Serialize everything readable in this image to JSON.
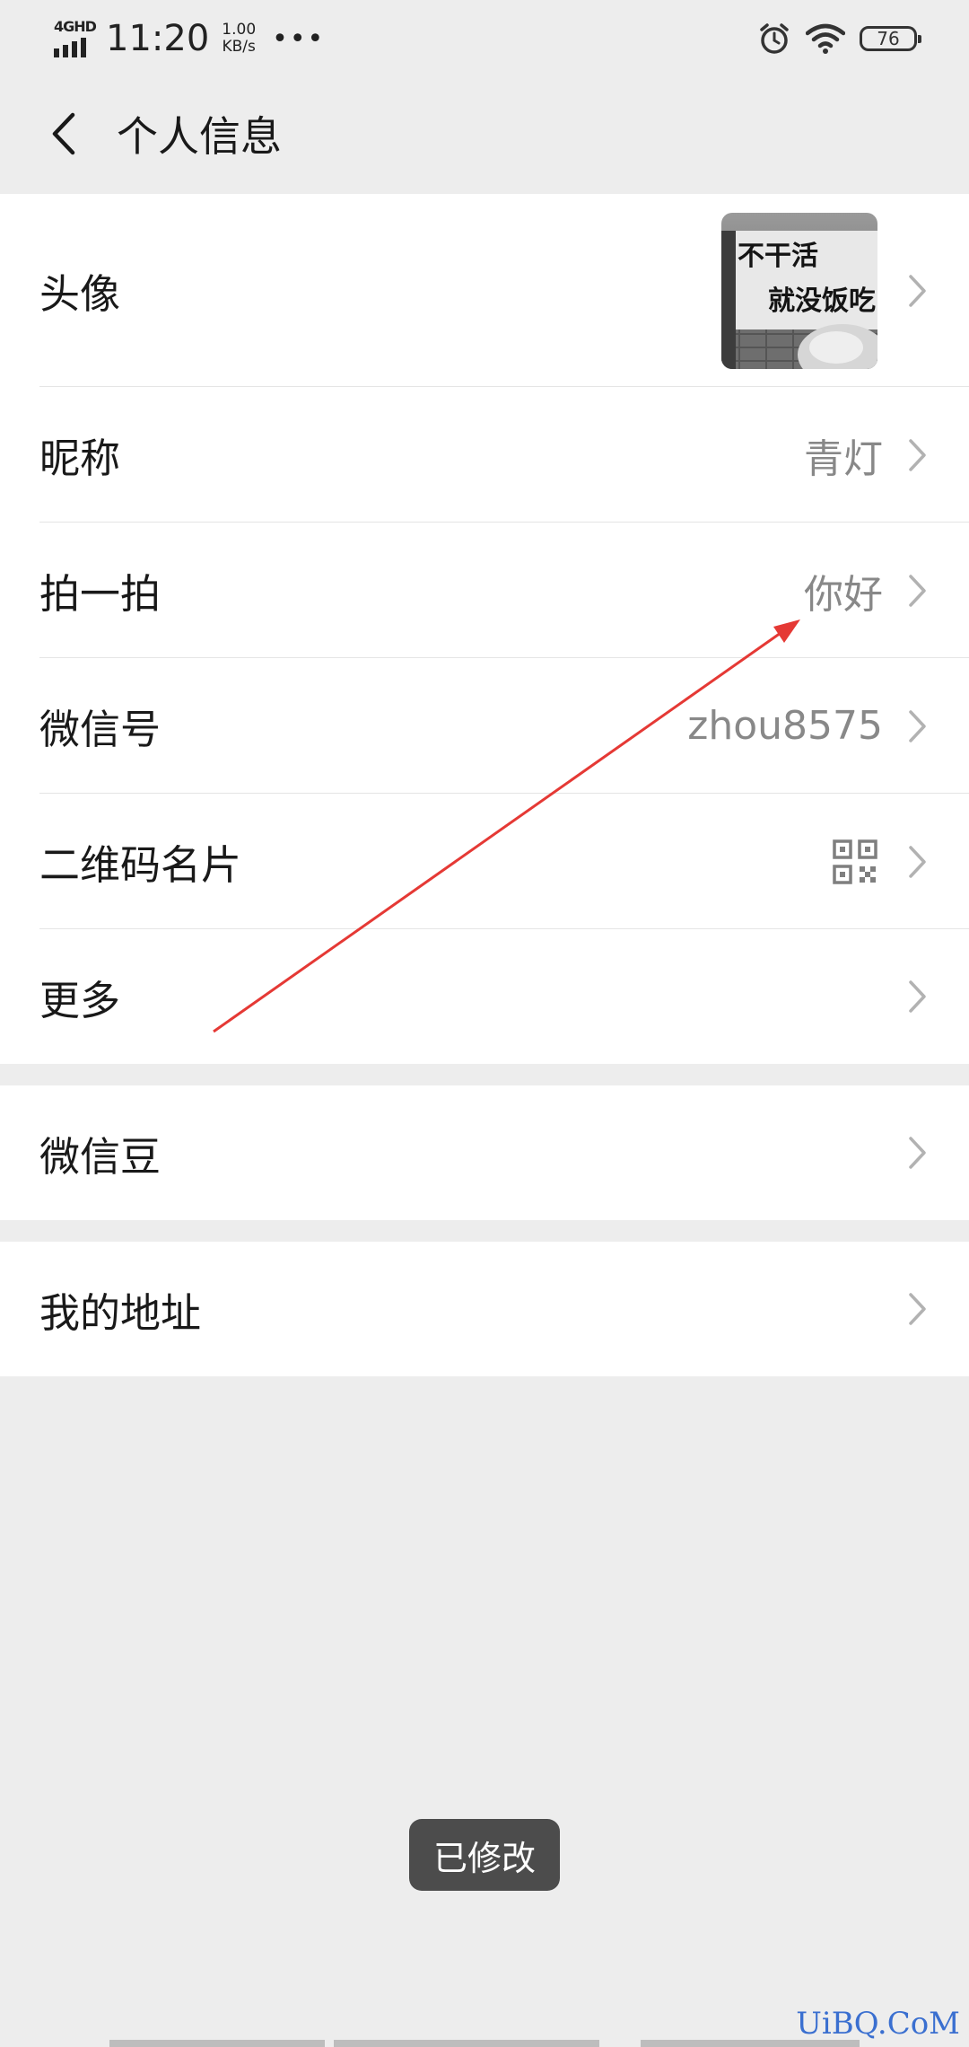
{
  "status_bar": {
    "network": "4GHD",
    "time": "11:20",
    "speed_value": "1.00",
    "speed_unit": "KB/s",
    "more": "•••",
    "battery": "76"
  },
  "nav": {
    "title": "个人信息"
  },
  "rows": {
    "avatar": {
      "label": "头像",
      "image_text_line1": "不干活",
      "image_text_line2": "就没饭吃"
    },
    "nickname": {
      "label": "昵称",
      "value": "青灯"
    },
    "pat": {
      "label": "拍一拍",
      "value": "你好"
    },
    "wechat_id": {
      "label": "微信号",
      "value": "zhou8575"
    },
    "qr_card": {
      "label": "二维码名片",
      "icon": "qr-code-icon"
    },
    "more": {
      "label": "更多"
    },
    "wechat_beans": {
      "label": "微信豆"
    },
    "address": {
      "label": "我的地址"
    }
  },
  "toast": {
    "text": "已修改"
  },
  "watermark": "UiBQ.CoM",
  "colors": {
    "background": "#ededed",
    "card": "#ffffff",
    "annotation_arrow": "#e53935",
    "toast_bg": "#4c4c4c"
  }
}
